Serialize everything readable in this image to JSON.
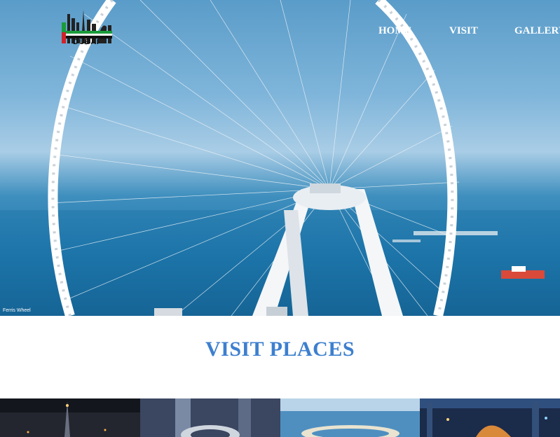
{
  "header": {
    "logo_icon": "dubai-skyline-logo",
    "logo_text": "DUBAI"
  },
  "nav": {
    "home": "HOME",
    "visit": "VISIT",
    "gallery": "GALLERY"
  },
  "hero": {
    "image": "ferris-wheel-over-sea",
    "caption": "Ferris Wheel"
  },
  "section": {
    "title": "VISIT PLACES"
  },
  "places": [
    {
      "image": "burj-khalifa-night"
    },
    {
      "image": "museum-of-the-future"
    },
    {
      "image": "palm-island-aerial"
    },
    {
      "image": "dubai-opera-night"
    }
  ],
  "colors": {
    "accent": "#3d7fcf",
    "nav_text": "#ffffff",
    "sky": "#7fb5da",
    "sea": "#1f78ad"
  }
}
